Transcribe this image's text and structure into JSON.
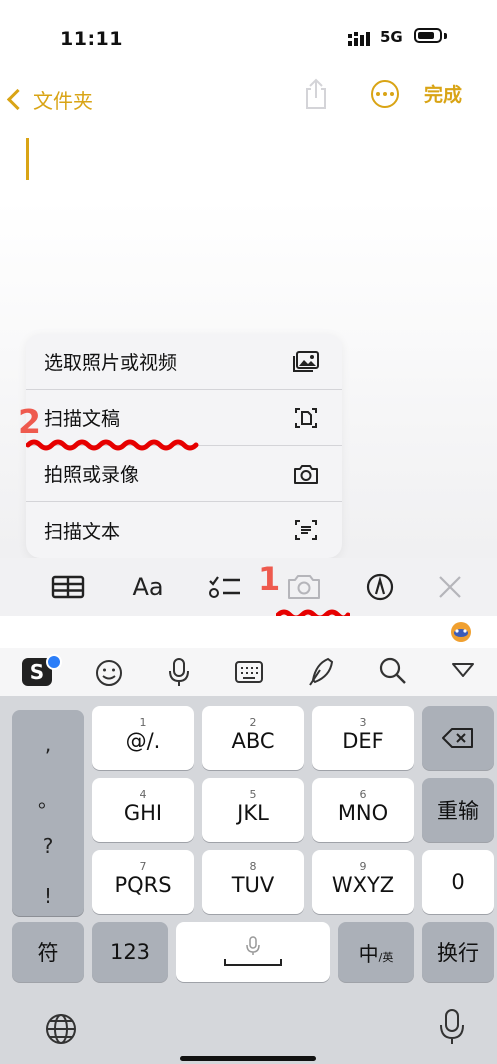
{
  "status_bar": {
    "time": "11:11",
    "network": "5G"
  },
  "nav": {
    "back_label": "文件夹",
    "done_label": "完成"
  },
  "menu": {
    "items": [
      {
        "label": "选取照片或视频",
        "icon": "photo-library-icon"
      },
      {
        "label": "扫描文稿",
        "icon": "scan-document-icon"
      },
      {
        "label": "拍照或录像",
        "icon": "camera-icon"
      },
      {
        "label": "扫描文本",
        "icon": "scan-text-icon"
      }
    ]
  },
  "annotations": {
    "step1": "1",
    "step2": "2",
    "color": "#ee5a4e"
  },
  "toolbar": {
    "items": [
      "table-icon",
      "format-text-icon",
      "checklist-icon",
      "camera-icon",
      "markup-icon",
      "close-icon"
    ],
    "format_label": "Aa"
  },
  "ime": {
    "items": [
      "sogou-logo",
      "emoji-icon",
      "microphone-icon",
      "keyboard-icon",
      "handwriting-icon",
      "search-icon",
      "collapse-icon"
    ],
    "logo_letter": "S"
  },
  "keyboard": {
    "punct": [
      ",",
      "。",
      "?",
      "!"
    ],
    "keys": [
      {
        "num": "1",
        "label": "@/."
      },
      {
        "num": "2",
        "label": "ABC"
      },
      {
        "num": "3",
        "label": "DEF"
      },
      {
        "num": "4",
        "label": "GHI"
      },
      {
        "num": "5",
        "label": "JKL"
      },
      {
        "num": "6",
        "label": "MNO"
      },
      {
        "num": "7",
        "label": "PQRS"
      },
      {
        "num": "8",
        "label": "TUV"
      },
      {
        "num": "9",
        "label": "WXYZ"
      }
    ],
    "retype": "重输",
    "zero": "0",
    "symbols": "符",
    "numbers": "123",
    "lang_zh": "中",
    "lang_en": "/英",
    "enter": "换行"
  },
  "colors": {
    "accent": "#d9a415",
    "annotation": "#ee5a4e"
  }
}
